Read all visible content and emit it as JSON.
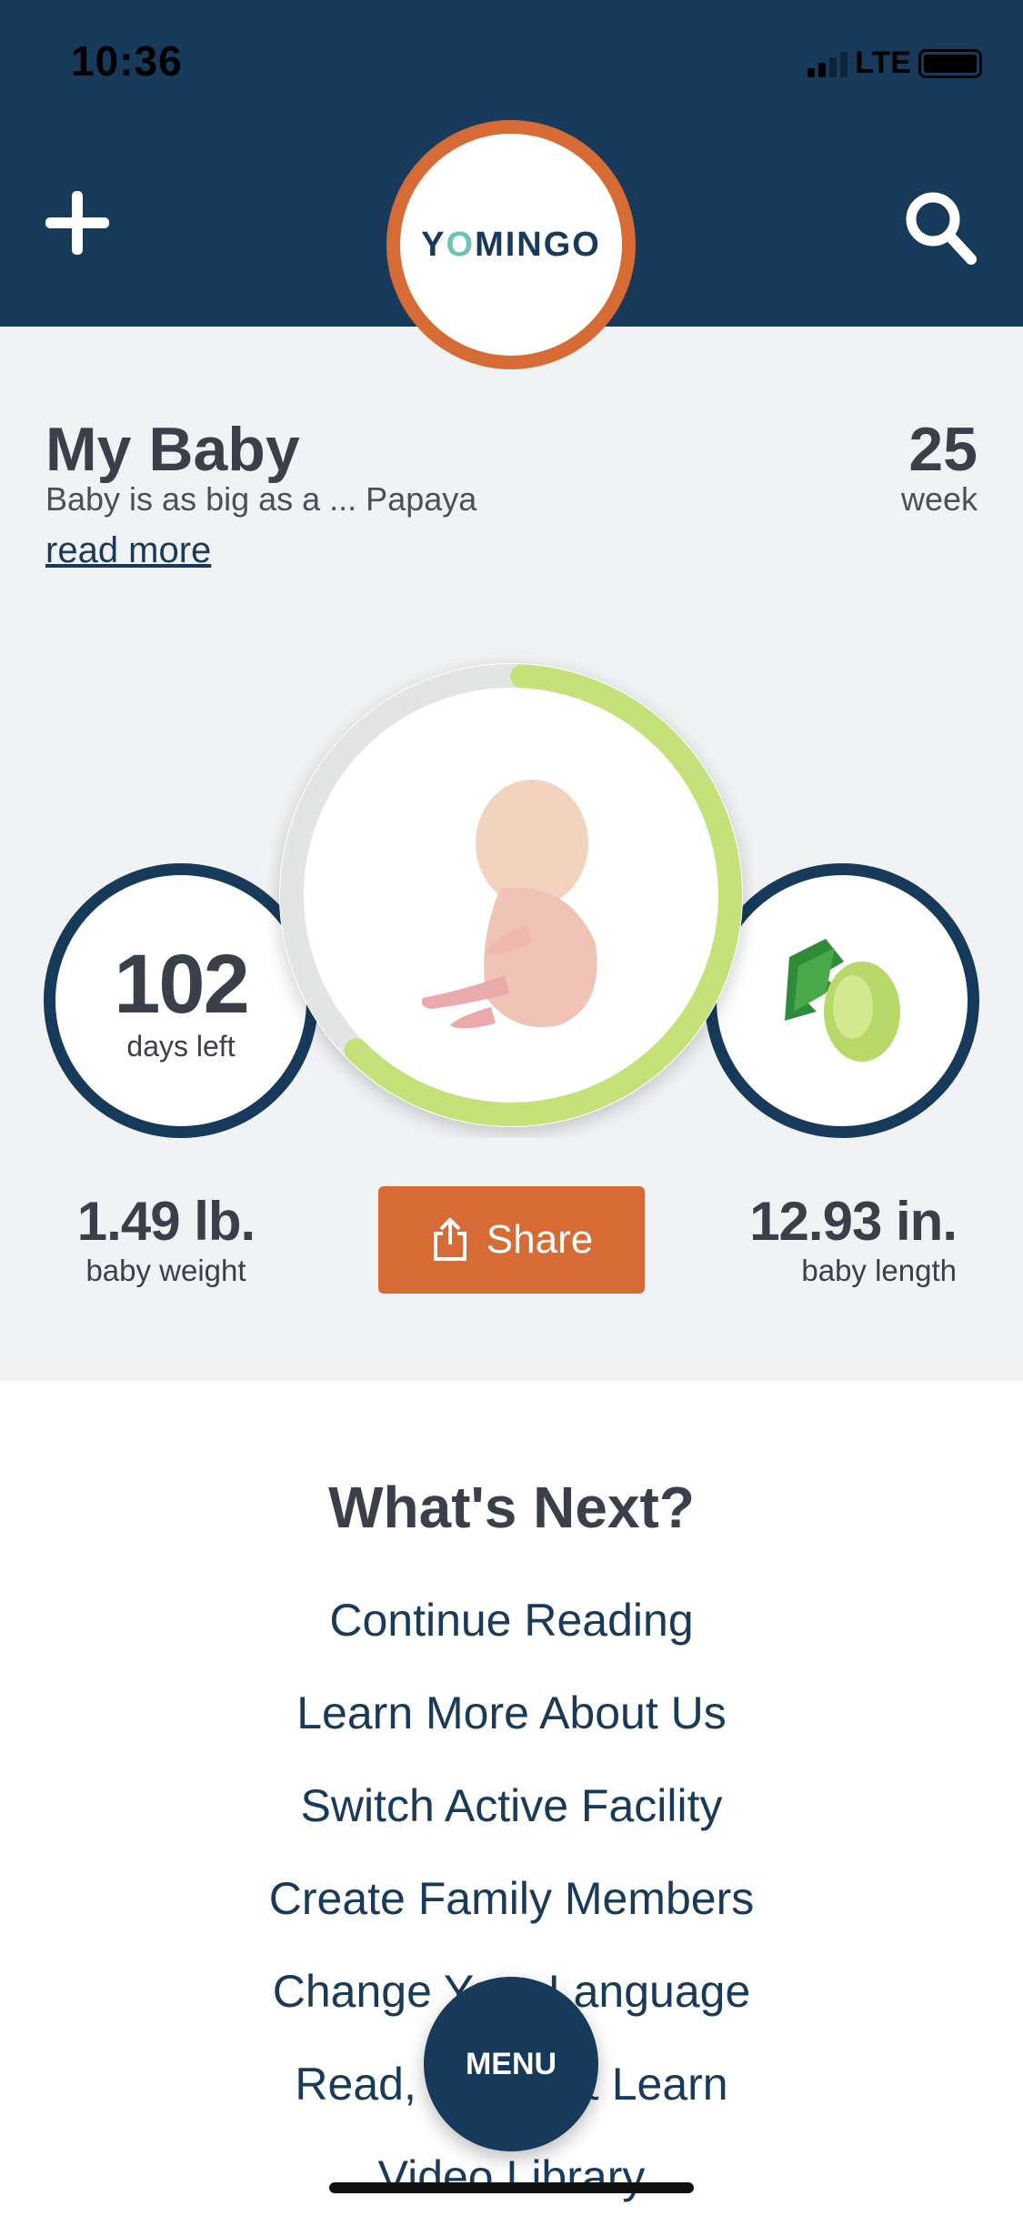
{
  "status_bar": {
    "time": "10:36",
    "network": "LTE"
  },
  "header": {
    "logo": "YOMINGO",
    "add_icon": "plus-icon",
    "search_icon": "search-icon"
  },
  "baby": {
    "title": "My Baby",
    "subtitle": "Baby is as big as a ... Papaya",
    "read_more": "read more",
    "week_number": "25",
    "week_label": "week",
    "progress_fraction": 0.625,
    "days_left": "102",
    "days_left_label": "days left",
    "weight": "1.49 lb.",
    "weight_label": "baby weight",
    "length": "12.93 in.",
    "length_label": "baby length",
    "share_label": "Share",
    "colors": {
      "ring": "#c5e27a",
      "accent": "#d66b35",
      "navy": "#173a5a"
    }
  },
  "whats_next": {
    "title": "What's Next?",
    "links": [
      "Continue Reading",
      "Learn More About Us",
      "Switch Active Facility",
      "Create Family Members",
      "Change Your Language",
      "Read, Watch & Learn",
      "Video Library"
    ]
  },
  "menu_label": "MENU"
}
